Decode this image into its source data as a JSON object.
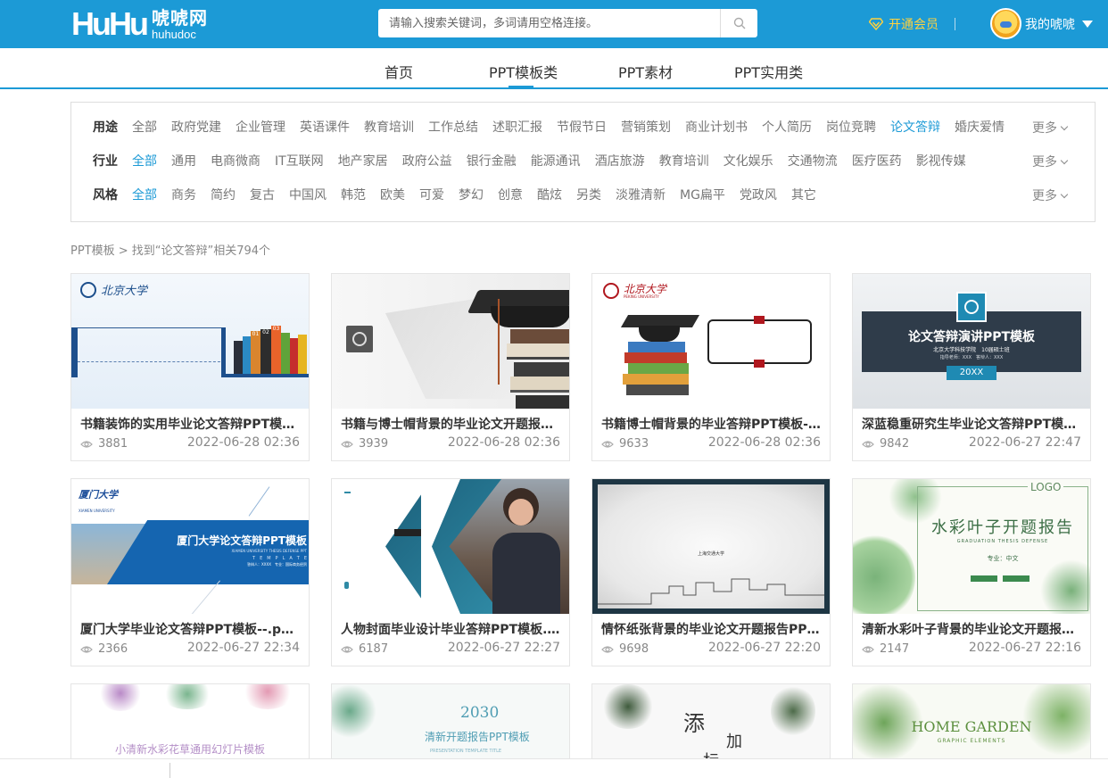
{
  "header": {
    "logo_mark": "HuHu",
    "logo_cn": "唬唬网",
    "logo_en": "huhudoc",
    "search_placeholder": "请输入搜索关键词，多词请用空格连接。",
    "vip_label": "开通会员",
    "user_label": "我的唬唬",
    "colors": {
      "brand": "#1c9ad6",
      "vip": "#ffd23e"
    }
  },
  "nav": {
    "items": [
      {
        "label": "首页"
      },
      {
        "label": "PPT模板类",
        "active": true
      },
      {
        "label": "PPT素材"
      },
      {
        "label": "PPT实用类"
      }
    ]
  },
  "filters": {
    "more_label": "更多",
    "rows": [
      {
        "label": "用途",
        "items": [
          "全部",
          "政府党建",
          "企业管理",
          "英语课件",
          "教育培训",
          "工作总结",
          "述职汇报",
          "节假节日",
          "营销策划",
          "商业计划书",
          "个人简历",
          "岗位竞聘",
          "论文答辩",
          "婚庆爱情"
        ],
        "selected": "论文答辩"
      },
      {
        "label": "行业",
        "items": [
          "全部",
          "通用",
          "电商微商",
          "IT互联网",
          "地产家居",
          "政府公益",
          "银行金融",
          "能源通讯",
          "酒店旅游",
          "教育培训",
          "文化娱乐",
          "交通物流",
          "医疗医药",
          "影视传媒"
        ],
        "selected": "全部"
      },
      {
        "label": "风格",
        "items": [
          "全部",
          "商务",
          "简约",
          "复古",
          "中国风",
          "韩范",
          "欧美",
          "可爱",
          "梦幻",
          "创意",
          "酷炫",
          "另类",
          "淡雅清新",
          "MG扁平",
          "党政风",
          "其它"
        ],
        "selected": "全部"
      }
    ]
  },
  "breadcrumb": "PPT模板 > 找到“论文答辩”相关794个",
  "cards": [
    {
      "title": "书籍装饰的实用毕业论文答辩PPT模板.pptx",
      "views": "3881",
      "date": "2022-06-28 02:36",
      "thumb_text": "北京大学",
      "thumb_book_labels": [
        "01",
        "02",
        "03"
      ]
    },
    {
      "title": "书籍与博士帽背景的毕业论文开题报告PPT模板.pptx",
      "views": "3939",
      "date": "2022-06-28 02:36"
    },
    {
      "title": "书籍博士帽背景的毕业答辩PPT模板--.pptx",
      "views": "9633",
      "date": "2022-06-28 02:36",
      "thumb_text": "北京大学",
      "thumb_subtext": "PEKING UNIVERSITY"
    },
    {
      "title": "深蓝稳重研究生毕业论文答辩PPT模板.pptx",
      "views": "9842",
      "date": "2022-06-27 22:47",
      "thumb_text": "论文答辩演讲PPT模板",
      "thumb_subtext": "北京大学科技学院　10届硕士班",
      "thumb_line": "指导老师：XXX　答辩人：XXX",
      "thumb_badge": "20XX"
    },
    {
      "title": "厦门大学毕业论文答辩PPT模板--.pptx",
      "views": "2366",
      "date": "2022-06-27 22:34",
      "thumb_text": "厦门大学论文答辩PPT模板",
      "thumb_logo": "厦门大学",
      "thumb_logo_en": "XIAMEN UNIVERSITY",
      "thumb_subtext": "XIAMEN UNIVERSITY THESIS DEFENSE PPT",
      "thumb_line": "T　E　M　P　L　A　T　E",
      "thumb_line2": "答辩人：XXXX　专业：国际商务经贸"
    },
    {
      "title": "人物封面毕业设计毕业答辩PPT模板.pptx",
      "views": "6187",
      "date": "2022-06-27 22:27"
    },
    {
      "title": "情怀纸张背景的毕业论文开题报告PPT模板.pptx",
      "views": "9698",
      "date": "2022-06-27 22:20",
      "thumb_text": "上海交通大学"
    },
    {
      "title": "清新水彩叶子背景的毕业论文开题报告PPT模板.pptx",
      "views": "2147",
      "date": "2022-06-27 22:16",
      "thumb_text": "水彩叶子开题报告",
      "thumb_logo": "LOGO",
      "thumb_subtext": "GRADUATION THESIS DEFENSE",
      "thumb_line": "专业：中文"
    }
  ],
  "partial_cards": [
    {
      "thumb_text": "小清新水彩花草通用幻灯片模板"
    },
    {
      "thumb_text": "清新开题报告PPT模板",
      "thumb_year": "2030",
      "thumb_subtext": "PRESENTATION TEMPLATE TITLE"
    },
    {
      "thumb_text": "添",
      "thumb_text2": "加",
      "thumb_text3": "标"
    },
    {
      "thumb_text": "HOME GARDEN",
      "thumb_subtext": "GRAPHIC ELEMENTS"
    }
  ]
}
